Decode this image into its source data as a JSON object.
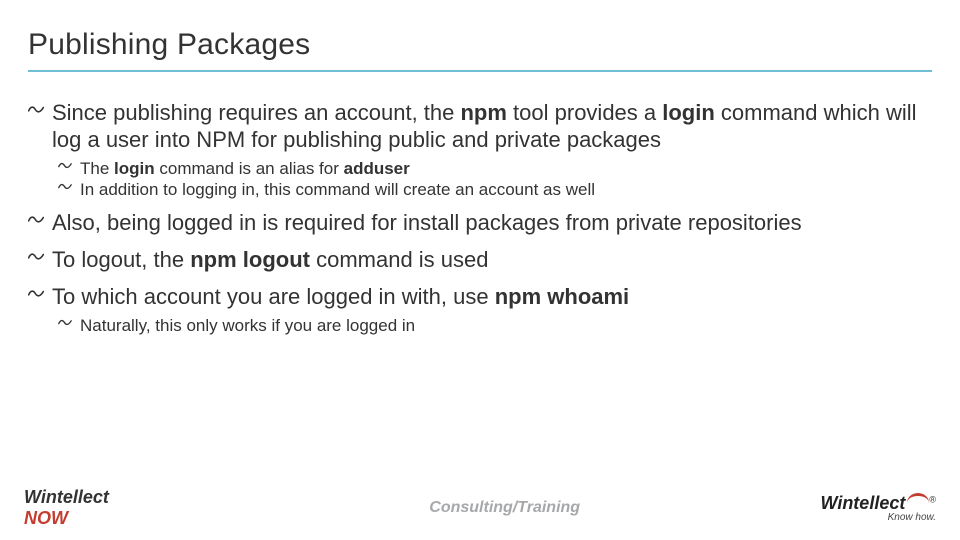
{
  "title": "Publishing Packages",
  "bullets": {
    "b1_a": "Since publishing requires an account, the ",
    "b1_b": "npm",
    "b1_c": " tool provides a ",
    "b1_d": "login",
    "b1_e": " command which will log a user into NPM for publishing public and private packages",
    "b1s1_a": "The ",
    "b1s1_b": "login",
    "b1s1_c": " command is an alias for ",
    "b1s1_d": "adduser",
    "b1s2": "In addition to logging in, this command will create an account as well",
    "b2": "Also, being logged in is required for install packages from private repositories",
    "b3_a": "To logout, the ",
    "b3_b": "npm logout",
    "b3_c": " command is used",
    "b4_a": "To which account you are logged in with, use ",
    "b4_b": "npm whoami",
    "b4s1": "Naturally, this only works if you are logged in"
  },
  "footer": {
    "left_a": "Wintellect",
    "left_b": "NOW",
    "center": "Consulting/Training",
    "right_brand": "Wintellect",
    "right_reg": "®",
    "right_tag": "Know how."
  }
}
